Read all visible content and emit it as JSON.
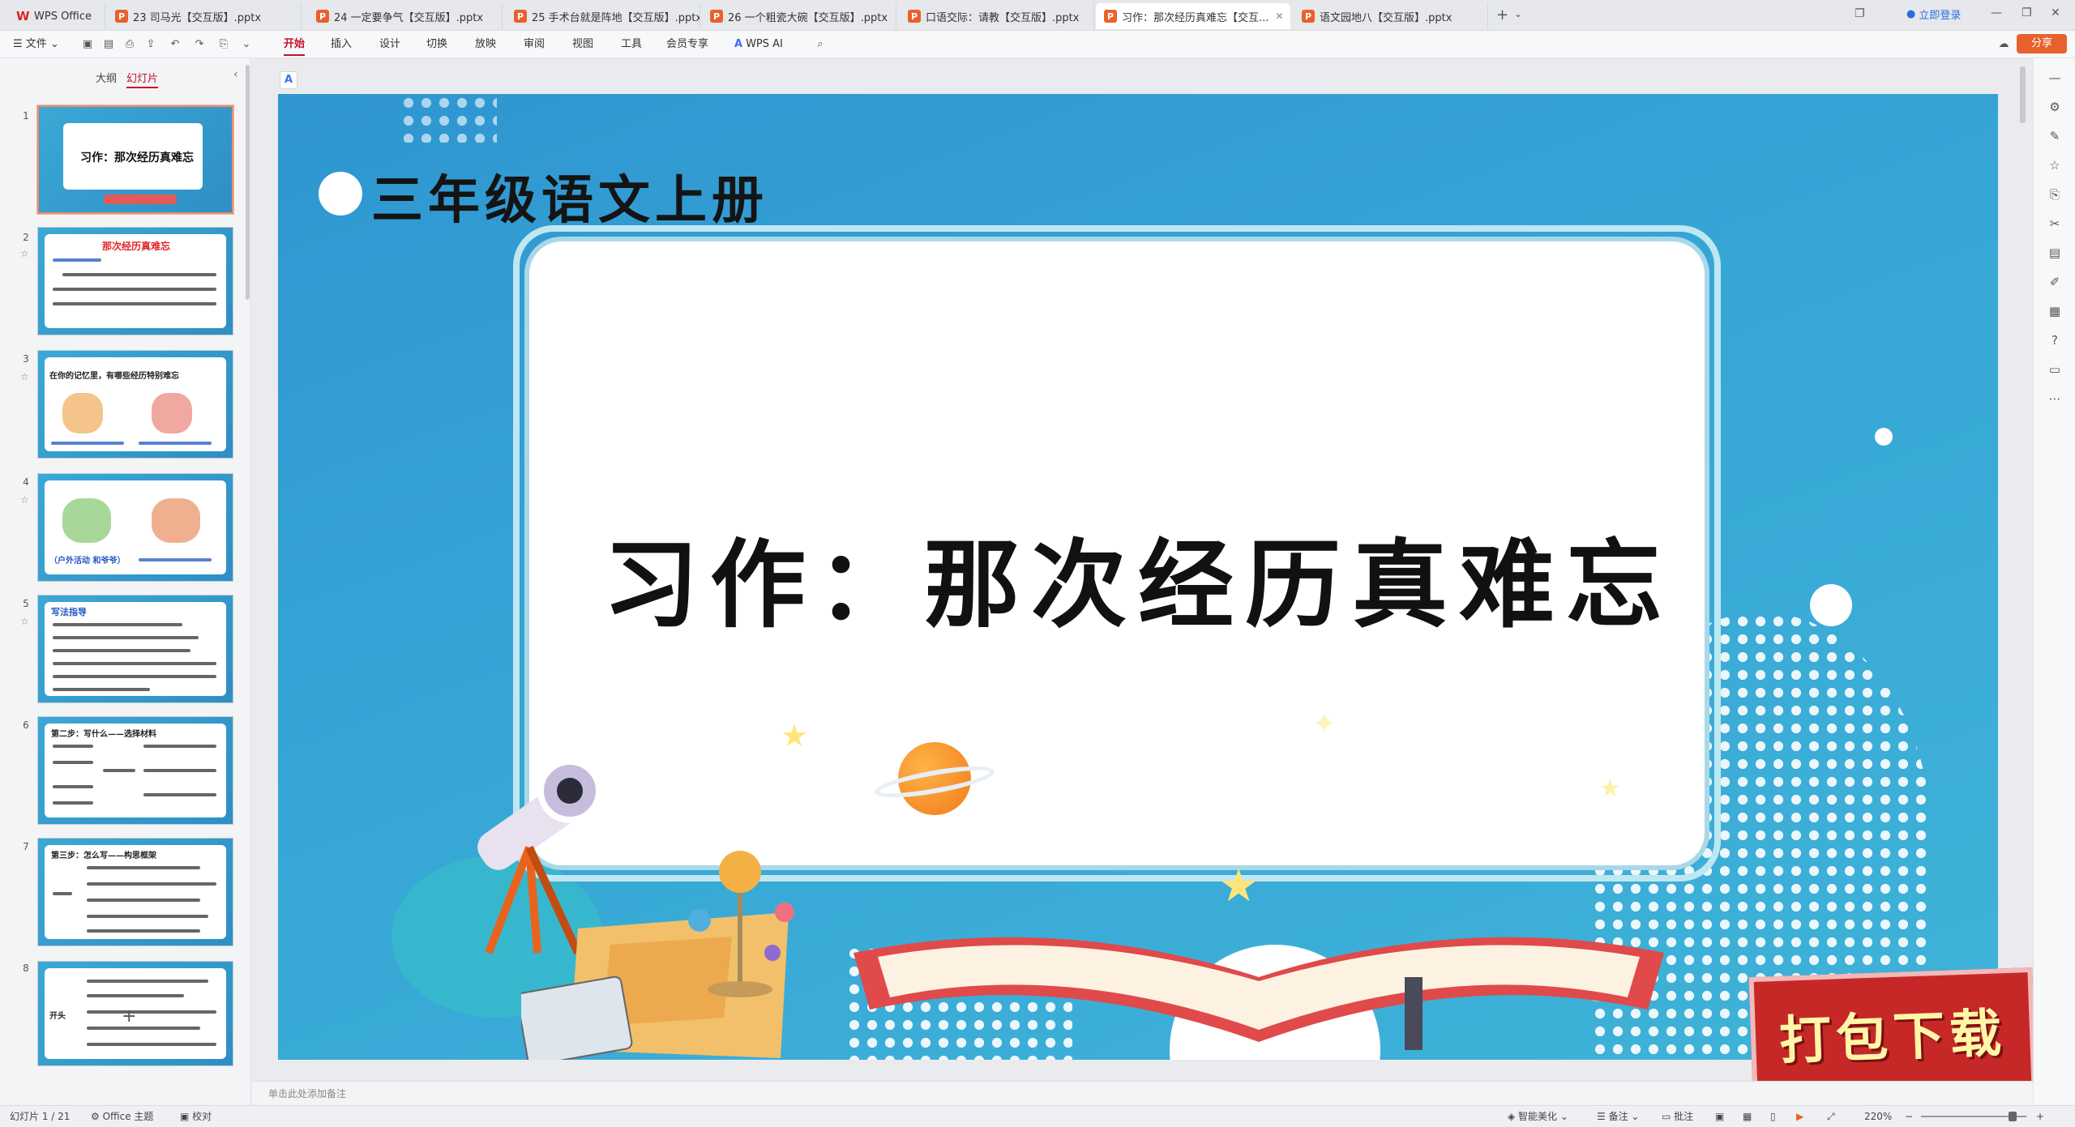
{
  "tabs": [
    {
      "label": "WPS Office",
      "type": "wps"
    },
    {
      "label": "23 司马光【交互版】.pptx",
      "type": "ppt"
    },
    {
      "label": "24 一定要争气【交互版】.pptx",
      "type": "ppt"
    },
    {
      "label": "25 手术台就是阵地【交互版】.pptx",
      "type": "ppt"
    },
    {
      "label": "26 一个粗瓷大碗【交互版】.pptx",
      "type": "ppt"
    },
    {
      "label": "口语交际：请教【交互版】.pptx",
      "type": "ppt"
    },
    {
      "label": "习作：那次经历真难忘【交互...",
      "type": "ppt",
      "active": true
    },
    {
      "label": "语文园地八【交互版】.pptx",
      "type": "ppt"
    }
  ],
  "titlebar": {
    "login": "立即登录",
    "share": "分享"
  },
  "menu": {
    "file": "文件",
    "items": [
      "开始",
      "插入",
      "设计",
      "切换",
      "放映",
      "审阅",
      "视图",
      "工具",
      "会员专享"
    ],
    "ai": "WPS AI"
  },
  "panel": {
    "tab_outline": "大纲",
    "tab_slides": "幻灯片"
  },
  "thumbs": [
    {
      "num": "1",
      "title": "习作：那次经历真难忘"
    },
    {
      "num": "2",
      "title": "那次经历真难忘"
    },
    {
      "num": "3",
      "title": "在你的记忆里，有哪些经历特别难忘"
    },
    {
      "num": "4",
      "title": "（户外活动 和爷爷）"
    },
    {
      "num": "5",
      "title": "写法指导"
    },
    {
      "num": "6",
      "title": "第二步：写什么——选择材料"
    },
    {
      "num": "7",
      "title": "第三步：怎么写——构思框架"
    },
    {
      "num": "8",
      "title": "开头"
    }
  ],
  "slide": {
    "title": "三年级语文上册",
    "heading": "习作：那次经历真难忘"
  },
  "badge": "打包下载",
  "notes_placeholder": "单击此处添加备注",
  "status": {
    "slide_count": "幻灯片 1 / 21",
    "theme": "Office 主题",
    "proof": "校对",
    "beautify": "智能美化",
    "notes": "备注",
    "comments": "批注",
    "zoom": "220%"
  }
}
